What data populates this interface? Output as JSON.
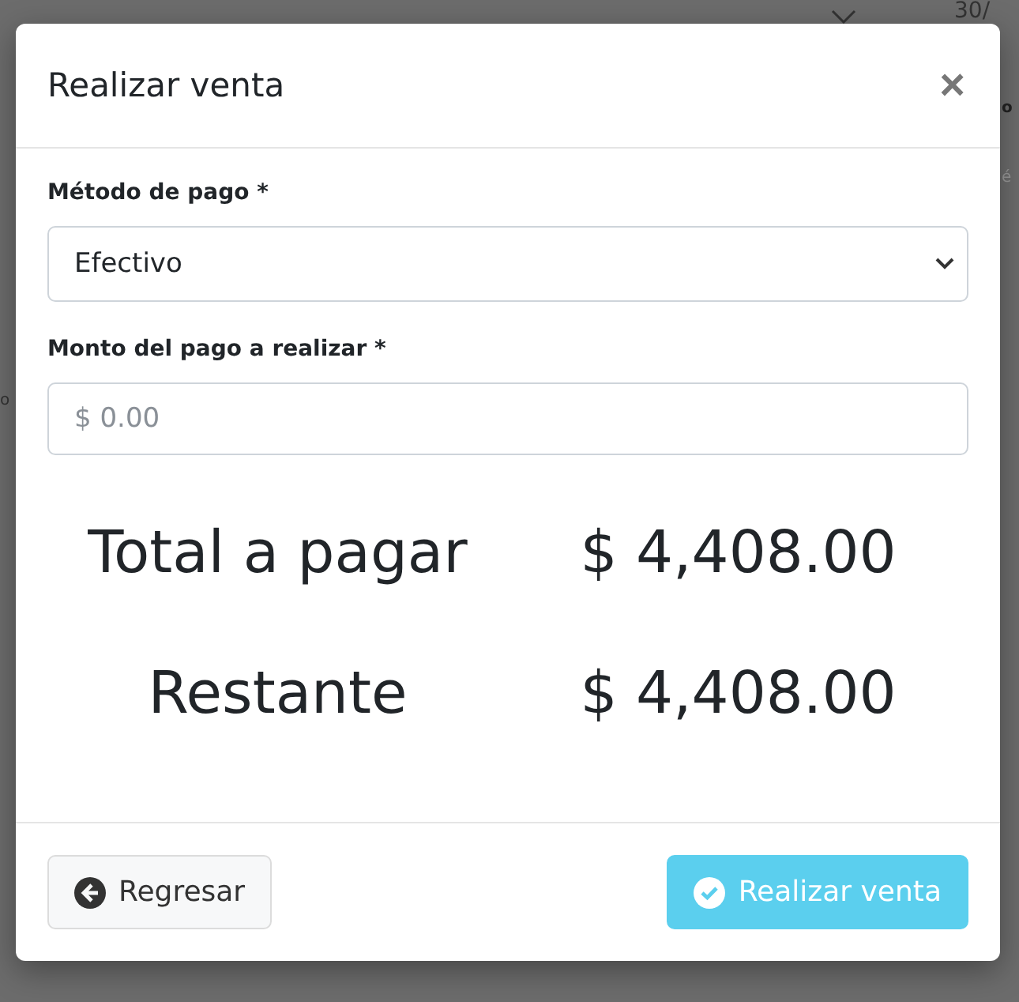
{
  "background": {
    "fragments": [
      "30/",
      "o",
      "é",
      "o"
    ]
  },
  "modal": {
    "title": "Realizar venta",
    "close": "×",
    "fields": [
      {
        "kind": "select",
        "label": "Método de pago *",
        "value": "Efectivo"
      },
      {
        "kind": "input",
        "label": "Monto del pago a realizar *",
        "placeholder": "$ 0.00"
      }
    ],
    "totals": [
      {
        "label": "Total a pagar",
        "value": "$ 4,408.00"
      },
      {
        "label": "Restante",
        "value": "$ 4,408.00"
      }
    ],
    "buttons": [
      {
        "kind": "back",
        "label": "Regresar"
      },
      {
        "kind": "submit",
        "label": "Realizar venta"
      }
    ]
  }
}
